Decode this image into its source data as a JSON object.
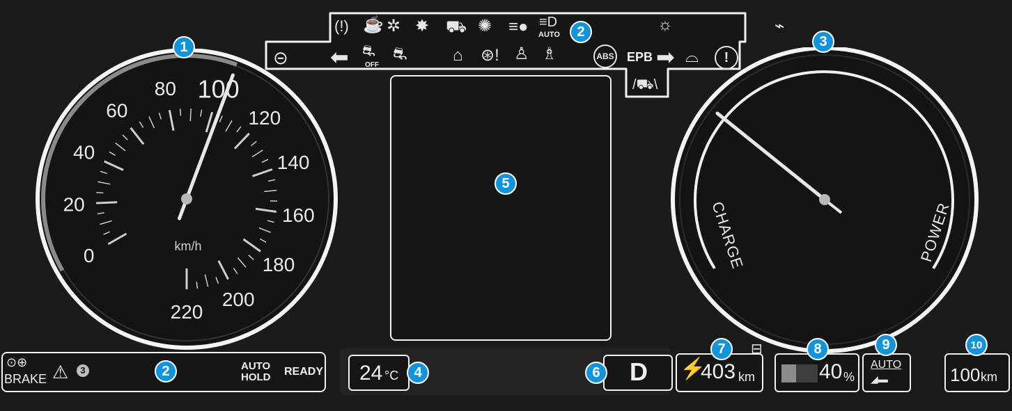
{
  "speedometer": {
    "ticks": [
      "0",
      "20",
      "40",
      "60",
      "80",
      "100",
      "120",
      "140",
      "160",
      "180",
      "200",
      "220"
    ],
    "unit": "km/h",
    "current_speed": 103
  },
  "power_gauge": {
    "charge_label": "CHARGE",
    "power_label": "POWER",
    "needle_value": 0.1
  },
  "telltales_top": {
    "epb_label": "EPB",
    "auto_label": "AUTO",
    "off_label": "OFF",
    "abs_label": "ABS"
  },
  "bottom_left": {
    "brake_label": "BRAKE",
    "auto_hold_line1": "AUTO",
    "auto_hold_line2": "HOLD",
    "ready_label": "READY",
    "warning_count": "3"
  },
  "temperature": {
    "value": "24",
    "unit": "°C"
  },
  "gear": {
    "value": "D"
  },
  "range": {
    "value": "403",
    "unit": "km"
  },
  "battery": {
    "value": "40",
    "unit": "%",
    "level": 0.4
  },
  "regen": {
    "label": "AUTO"
  },
  "trip": {
    "value": "100",
    "unit": "km"
  },
  "callouts": {
    "n1": "1",
    "n2a": "2",
    "n2b": "2",
    "n3": "3",
    "n4": "4",
    "n5": "5",
    "n6": "6",
    "n7": "7",
    "n8": "8",
    "n9": "9",
    "n10": "10"
  },
  "colors": {
    "callout": "#1593d8",
    "panel": "#161616",
    "needle": "#e8e8e8"
  }
}
